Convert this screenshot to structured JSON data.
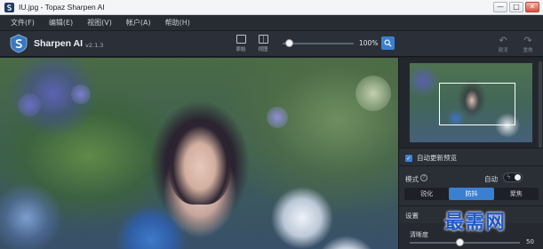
{
  "window": {
    "title": "IU.jpg - Topaz Sharpen AI",
    "controls": [
      "—",
      "□",
      "✕"
    ]
  },
  "menu": {
    "items": [
      "文件(F)",
      "编辑(E)",
      "视图(V)",
      "帐户(A)",
      "帮助(H)"
    ]
  },
  "toolbar": {
    "brand": "Sharpen AI",
    "version": "v2.1.3",
    "view_single_label": "原始",
    "view_split_label": "视图",
    "zoom_value": "100%",
    "zoom_slider_fraction": 0.05,
    "undo_label": "撤消",
    "redo_label": "重做"
  },
  "panel": {
    "auto_update_preview_label": "自动更新预览",
    "auto_update_checked": true,
    "mode_label": "模式",
    "auto_label": "自动",
    "modes": [
      "锐化",
      "防抖",
      "聚焦"
    ],
    "active_mode": "防抖",
    "settings_label": "设置",
    "param_label": "清晰度",
    "param_value": "50"
  },
  "watermark": "最需网",
  "colors": {
    "accent": "#3b7fd1",
    "background": "#2a2e35"
  }
}
